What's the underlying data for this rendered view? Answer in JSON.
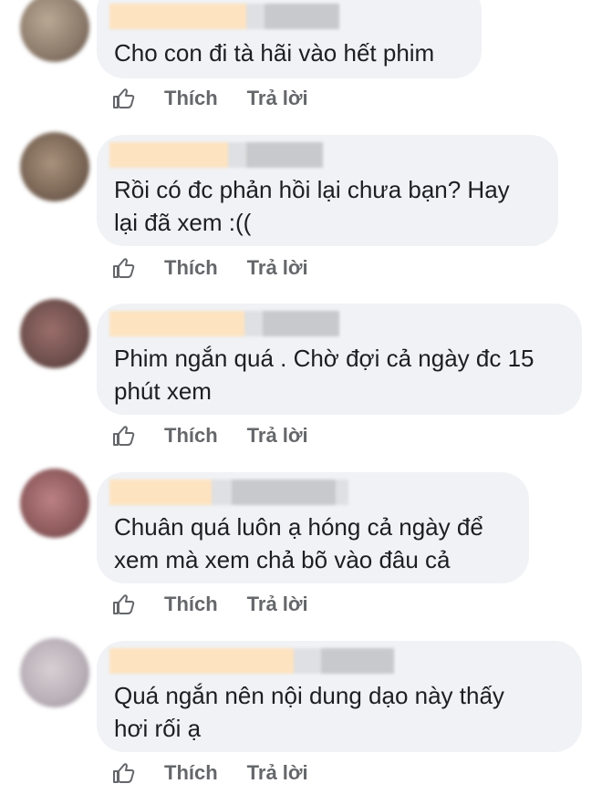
{
  "comments": [
    {
      "text_lines": [
        "Cho con đi tà hãi vào hết phim"
      ],
      "like_label": "Thích",
      "reply_label": "Trả lời",
      "avatar_color": "#8c7a6a"
    },
    {
      "text_lines": [
        "Rồi có đc phản hồi lại chưa bạn? Hay",
        "lại đã xem :(("
      ],
      "like_label": "Thích",
      "reply_label": "Trả lời",
      "avatar_color": "#7a6555"
    },
    {
      "text_lines": [
        "Phim ngắn quá . Chờ đợi cả ngày đc 15",
        "phút xem"
      ],
      "like_label": "Thích",
      "reply_label": "Trả lời",
      "avatar_color": "#6e4f4c"
    },
    {
      "text_lines": [
        "Chuân quá luôn ạ hóng cả ngày để",
        "xem mà xem chả bõ vào đâu cả"
      ],
      "like_label": "Thích",
      "reply_label": "Trả lời",
      "avatar_color": "#8e5a5c"
    },
    {
      "text_lines": [
        "Quá ngắn nên nội dung dạo này thấy",
        "hơi rối ạ"
      ],
      "like_label": "Thích",
      "reply_label": "Trả lời",
      "avatar_color": "#b9b0b7"
    }
  ]
}
